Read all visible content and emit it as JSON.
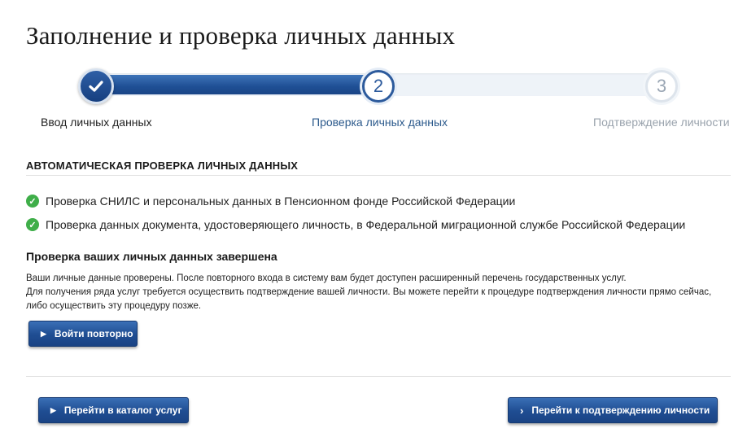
{
  "page": {
    "title": "Заполнение и проверка личных данных"
  },
  "progress": {
    "steps": [
      {
        "number": "1",
        "label": "Ввод личных данных",
        "state": "done"
      },
      {
        "number": "2",
        "label": "Проверка личных данных",
        "state": "current"
      },
      {
        "number": "3",
        "label": "Подтверждение личности",
        "state": "pending"
      }
    ],
    "colors": {
      "active": "#1f4f95",
      "done_check": "#ffffff",
      "pending": "#9aa6b4"
    }
  },
  "auto_check": {
    "title": "АВТОМАТИЧЕСКАЯ ПРОВЕРКА ЛИЧНЫХ ДАННЫХ",
    "items": [
      "Проверка СНИЛС и персональных данных в Пенсионном фонде Российской Федерации",
      "Проверка данных документа, удостоверяющего личность, в Федеральной миграционной службе Российской Федерации"
    ],
    "icon": "check-circle-icon",
    "icon_color": "#3fae49"
  },
  "completion": {
    "title": "Проверка ваших личных данных завершена",
    "line1": "Ваши личные данные проверены. После повторного входа в систему вам будет доступен расширенный перечень государственных услуг.",
    "line2": "Для получения ряда услуг требуется осуществить подтверждение вашей личности. Вы можете перейти к процедуре подтверждения личности прямо сейчас, либо осуществить эту процедуру позже.",
    "retry_button": "Войти повторно"
  },
  "footer": {
    "catalog_button": "Перейти в каталог услуг",
    "confirm_button": "Перейти к подтверждению личности"
  }
}
